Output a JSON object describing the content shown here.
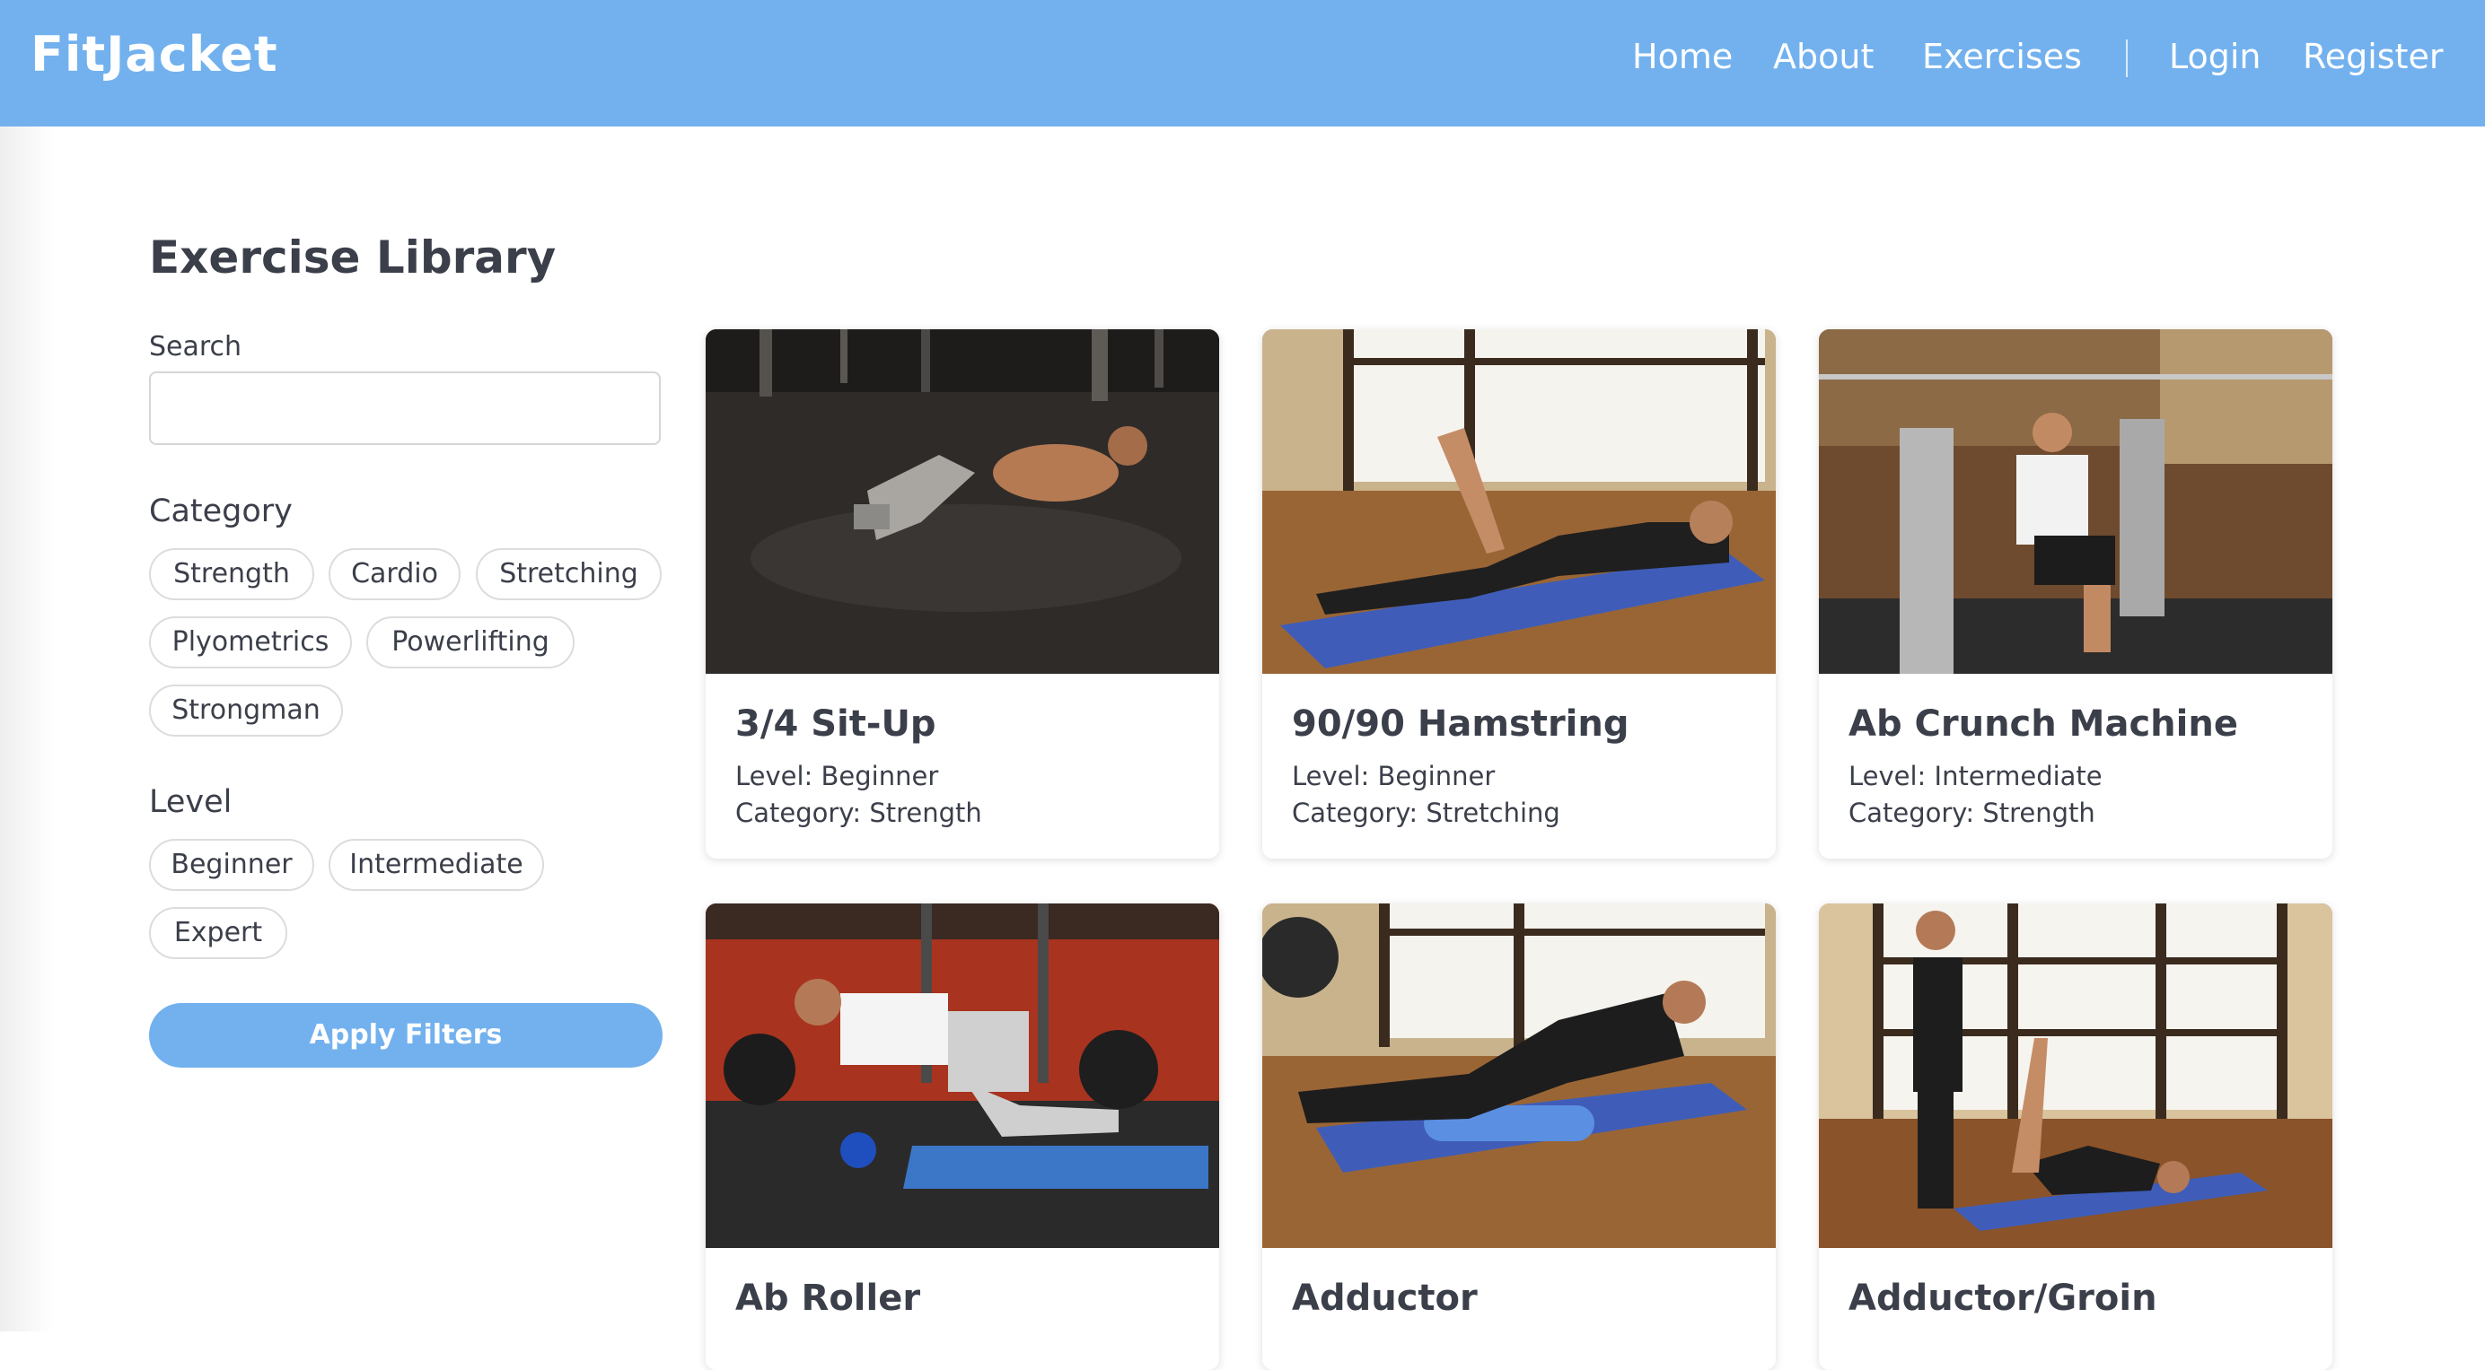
{
  "header": {
    "brand": "FitJacket",
    "nav": {
      "home": "Home",
      "about": "About",
      "exercises": "Exercises",
      "login": "Login",
      "register": "Register"
    }
  },
  "sidebar": {
    "title": "Exercise Library",
    "search_label": "Search",
    "search_value": "",
    "category_heading": "Category",
    "categories": [
      "Strength",
      "Cardio",
      "Stretching",
      "Plyometrics",
      "Powerlifting",
      "Strongman"
    ],
    "level_heading": "Level",
    "levels": [
      "Beginner",
      "Intermediate",
      "Expert"
    ],
    "apply_label": "Apply Filters"
  },
  "exercises": [
    {
      "name": "3/4 Sit-Up",
      "level": "Level: Beginner",
      "category": "Category: Strength"
    },
    {
      "name": "90/90 Hamstring",
      "level": "Level: Beginner",
      "category": "Category: Stretching"
    },
    {
      "name": "Ab Crunch Machine",
      "level": "Level: Intermediate",
      "category": "Category: Strength"
    },
    {
      "name": "Ab Roller"
    },
    {
      "name": "Adductor"
    },
    {
      "name": "Adductor/Groin"
    }
  ],
  "colors": {
    "accent": "#72b1ee",
    "text": "#3b3f4a",
    "chip_border": "#dcdcdc"
  }
}
